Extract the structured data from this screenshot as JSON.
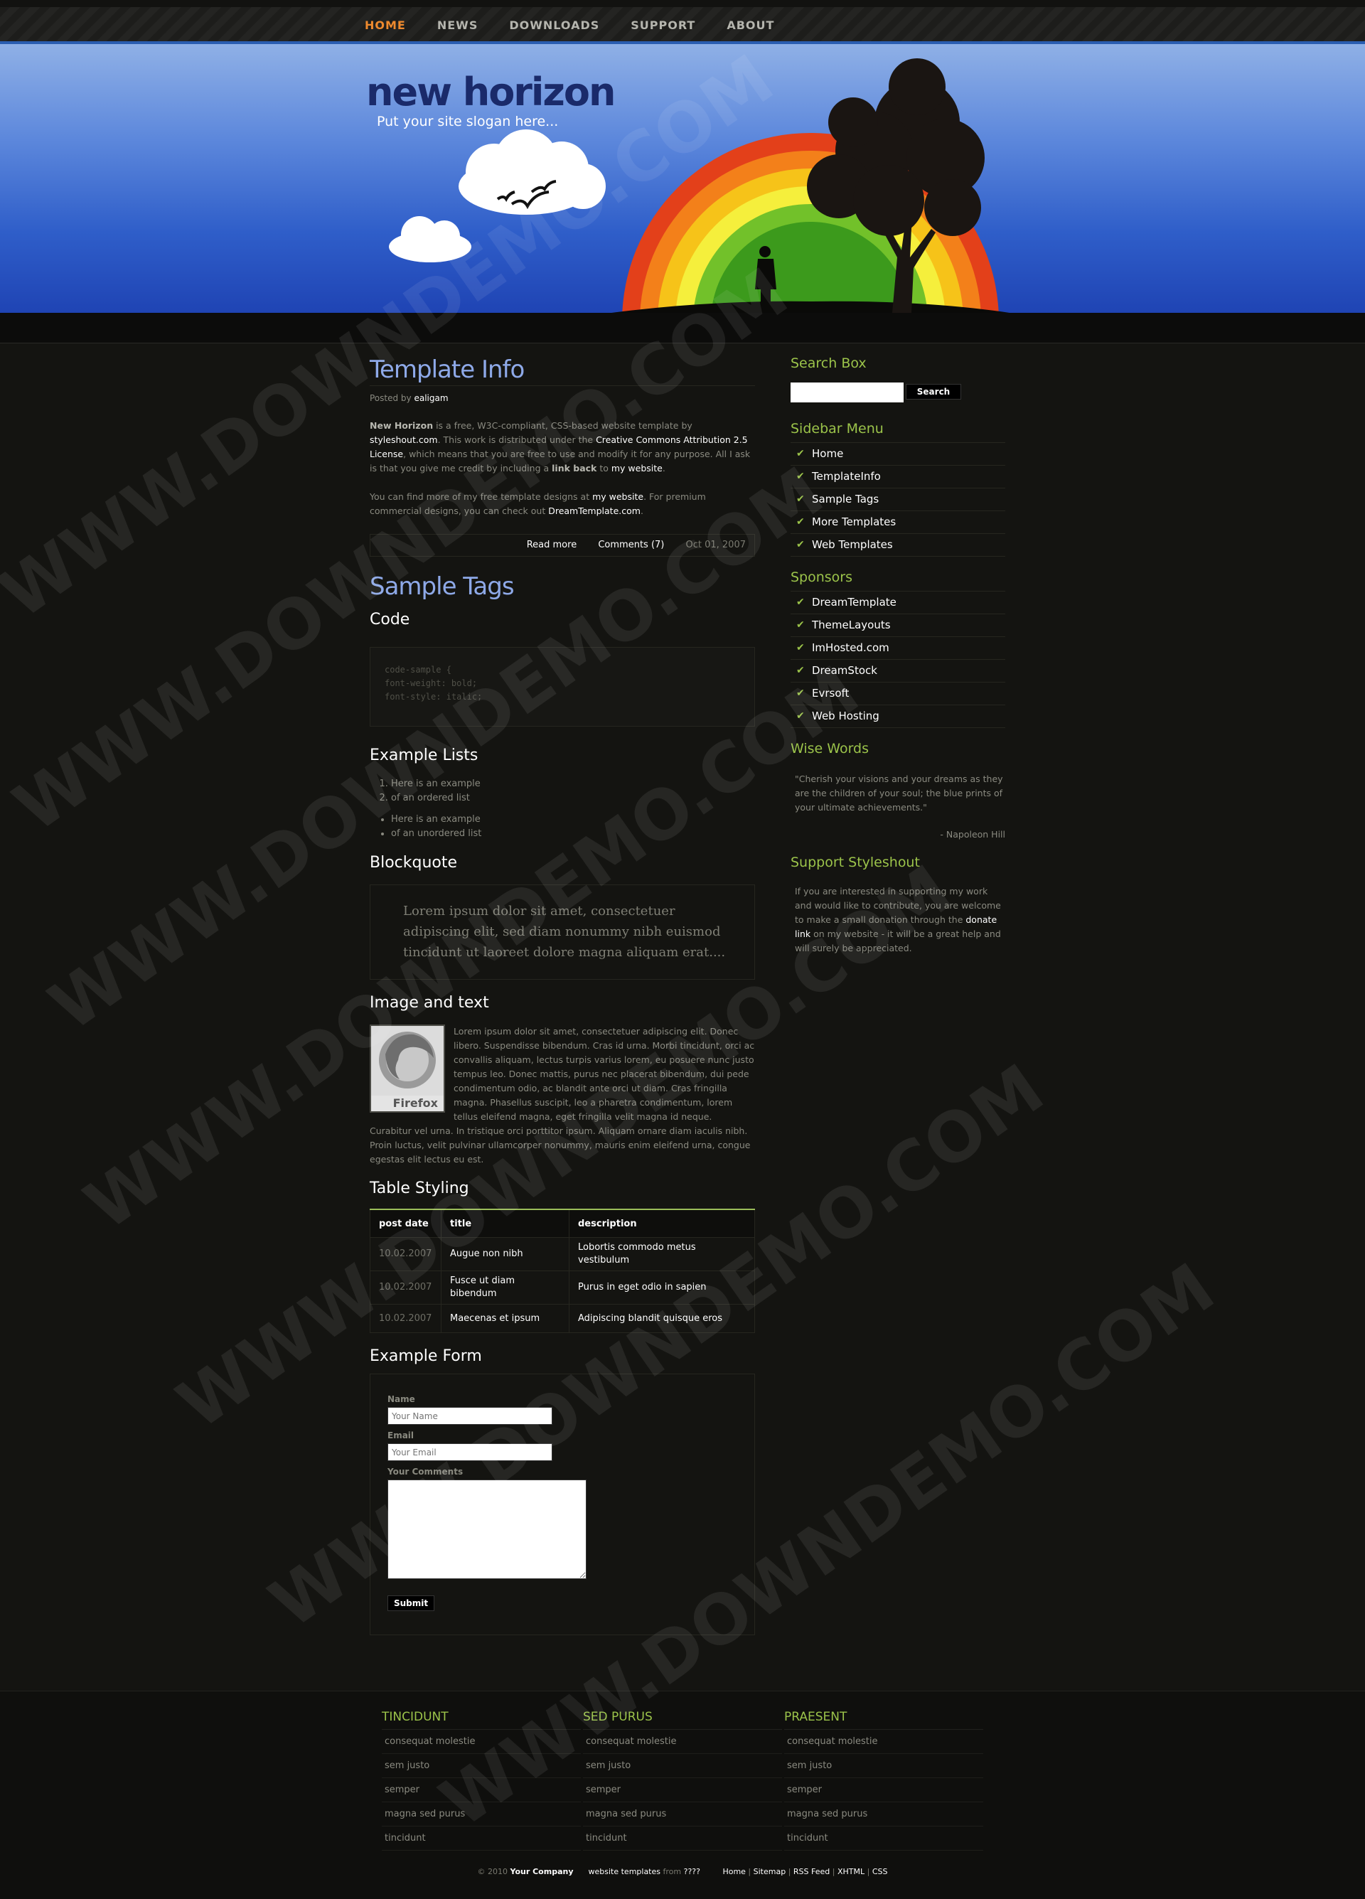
{
  "nav": {
    "items": [
      {
        "label": "HOME",
        "current": true
      },
      {
        "label": "NEWS"
      },
      {
        "label": "DOWNLOADS"
      },
      {
        "label": "SUPPORT"
      },
      {
        "label": "ABOUT"
      }
    ]
  },
  "header": {
    "logo": "new horizon",
    "slogan": "Put your site slogan here..."
  },
  "post1": {
    "title": "Template Info",
    "posted_prefix": "Posted by",
    "author": "ealigam",
    "p1_b1": "New Horizon",
    "p1_t1": " is a free, W3C-compliant, CSS-based website template by ",
    "p1_a1": "styleshout.com",
    "p1_t2": ". This work is distributed under the ",
    "p1_a2": "Creative Commons Attribution 2.5 License",
    "p1_t3": ", which means that you are free to use and modify it for any purpose. All I ask is that you give me credit by including a ",
    "p1_b2": "link back",
    "p1_t4": " to ",
    "p1_a3": "my website",
    "p1_t5": ".",
    "p2_t1": "You can find more of my free template designs at ",
    "p2_a1": "my website",
    "p2_t2": ". For premium commercial designs, you can check out ",
    "p2_a2": "DreamTemplate.com",
    "p2_t3": ".",
    "read_more": "Read more",
    "comments": "Comments (7)",
    "date": "Oct 01, 2007"
  },
  "post2": {
    "title": "Sample Tags",
    "code_h": "Code",
    "code_lines": [
      "code-sample {",
      "font-weight: bold;",
      "font-style: italic;"
    ],
    "lists_h": "Example Lists",
    "ol": [
      "Here is an example",
      "of an ordered list"
    ],
    "ul": [
      "Here is an example",
      "of an unordered list"
    ],
    "quote_h": "Blockquote",
    "quote": "Lorem ipsum dolor sit amet, consectetuer adipiscing elit, sed diam nonummy nibh euismod tincidunt ut laoreet dolore magna aliquam erat....",
    "img_h": "Image and text",
    "img_caption": "Firefox",
    "img_text": "Lorem ipsum dolor sit amet, consectetuer adipiscing elit. Donec libero. Suspendisse bibendum. Cras id urna. Morbi tincidunt, orci ac convallis aliquam, lectus turpis varius lorem, eu posuere nunc justo tempus leo. Donec mattis, purus nec placerat bibendum, dui pede condimentum odio, ac blandit ante orci ut diam. Cras fringilla magna. Phasellus suscipit, leo a pharetra condimentum, lorem tellus eleifend magna, eget fringilla velit magna id neque. Curabitur vel urna. In tristique orci porttitor ipsum. Aliquam ornare diam iaculis nibh. Proin luctus, velit pulvinar ullamcorper nonummy, mauris enim eleifend urna, congue egestas elit lectus eu est.",
    "table_h": "Table Styling",
    "table_headers": [
      "post date",
      "title",
      "description"
    ],
    "table_rows": [
      [
        "10.02.2007",
        "Augue non nibh",
        "Lobortis commodo metus vestibulum"
      ],
      [
        "10.02.2007",
        "Fusce ut diam bibendum",
        "Purus in eget odio in sapien"
      ],
      [
        "10.02.2007",
        "Maecenas et ipsum",
        "Adipiscing blandit quisque eros"
      ]
    ],
    "form_h": "Example Form",
    "form_name_label": "Name",
    "form_name_ph": "Your Name",
    "form_email_label": "Email",
    "form_email_ph": "Your Email",
    "form_comments_label": "Your Comments",
    "form_submit": "Submit"
  },
  "sidebar": {
    "search_h": "Search Box",
    "search_btn": "Search",
    "menu_h": "Sidebar Menu",
    "menu": [
      "Home",
      "TemplateInfo",
      "Sample Tags",
      "More Templates",
      "Web Templates"
    ],
    "sponsors_h": "Sponsors",
    "sponsors": [
      "DreamTemplate",
      "ThemeLayouts",
      "ImHosted.com",
      "DreamStock",
      "Evrsoft",
      "Web Hosting"
    ],
    "wise_h": "Wise Words",
    "wise_quote": "\"Cherish your visions and your dreams as they are the children of your soul; the blue prints of your ultimate achievements.\"",
    "wise_author": "- Napoleon Hill",
    "support_h": "Support Styleshout",
    "support_t1": "If you are interested in supporting my work and would like to contribute, you are welcome to make a small donation through the ",
    "support_a": "donate link",
    "support_t2": " on my website - it will be a great help and will surely be appreciated."
  },
  "footer": {
    "cols": [
      {
        "title": "TINCIDUNT",
        "items": [
          "consequat molestie",
          "sem justo",
          "semper",
          "magna sed purus",
          "tincidunt"
        ]
      },
      {
        "title": "SED PURUS",
        "items": [
          "consequat molestie",
          "sem justo",
          "semper",
          "magna sed purus",
          "tincidunt"
        ]
      },
      {
        "title": "PRAESENT",
        "items": [
          "consequat molestie",
          "sem justo",
          "semper",
          "magna sed purus",
          "tincidunt"
        ]
      }
    ],
    "copyright": "© 2010",
    "company": "Your Company",
    "templates_link": "website templates",
    "from": "from",
    "from_site": "????",
    "links": [
      "Home",
      "Sitemap",
      "RSS Feed",
      "XHTML",
      "CSS"
    ]
  },
  "watermark": "WWW.DOWNDEMO.COM",
  "colors": {
    "accent_green": "#9bc34a",
    "title_blue": "#8ea9e8",
    "nav_current": "#ee8a2e",
    "header_blue": "#2f5ec9"
  }
}
